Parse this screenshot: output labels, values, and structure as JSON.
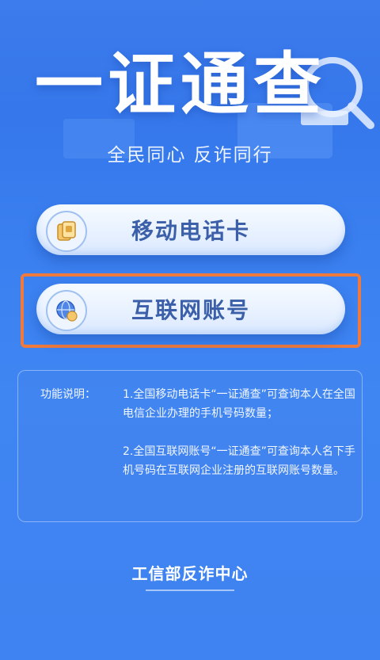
{
  "hero": {
    "title": "一证通查",
    "slogan": "全民同心  反诈同行"
  },
  "buttons": [
    {
      "label": "移动电话卡",
      "icon": "sim-card-icon"
    },
    {
      "label": "互联网账号",
      "icon": "globe-user-icon"
    }
  ],
  "info": {
    "label": "功能说明：",
    "items": [
      "1.全国移动电话卡“一证通查”可查询本人在全国电信企业办理的手机号码数量；",
      "2.全国互联网账号“一证通查”可查询本人名下手机号码在互联网企业注册的互联网账号数量。"
    ]
  },
  "footer": {
    "text": "工信部反诈中心"
  },
  "colors": {
    "background": "#3a7ff0",
    "highlight": "#f07a3c",
    "button_text": "#3b5fa9"
  }
}
